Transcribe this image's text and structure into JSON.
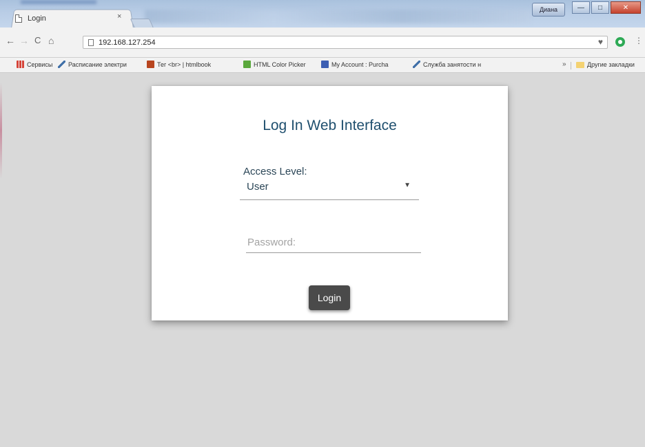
{
  "browser": {
    "tab": {
      "title": "Login",
      "close": "×"
    },
    "window_buttons": {
      "user": "Диана",
      "minimize": "—",
      "maximize": "□",
      "close": "✕"
    },
    "toolbar": {
      "back": "←",
      "forward": "→",
      "reload": "C",
      "home": "⌂",
      "url": "192.168.127.254",
      "star": "♥",
      "menu": "⋮"
    },
    "bookmarks": [
      {
        "label": "Сервисы",
        "icon": "apps-grid-icon",
        "color": "#d6453a"
      },
      {
        "label": "Расписание электри",
        "icon": "pencil-icon",
        "color": "#3f6fa8"
      },
      {
        "label": "Тег <br> | htmlbook",
        "icon": "htmlbook-icon",
        "color": "#b8451f"
      },
      {
        "label": "HTML Color Picker",
        "icon": "color-picker-icon",
        "color": "#5aa83c"
      },
      {
        "label": "My Account : Purcha",
        "icon": "account-icon",
        "color": "#3d5fb3"
      },
      {
        "label": "Служба занятости н",
        "icon": "pencil-icon",
        "color": "#3f6fa8"
      }
    ],
    "bookmarks_overflow": "»",
    "other_bookmarks": "Другие закладки"
  },
  "login": {
    "title": "Log In Web Interface",
    "access_label": "Access Level:",
    "access_value": "User",
    "password_placeholder": "Password:",
    "login_button": "Login"
  }
}
